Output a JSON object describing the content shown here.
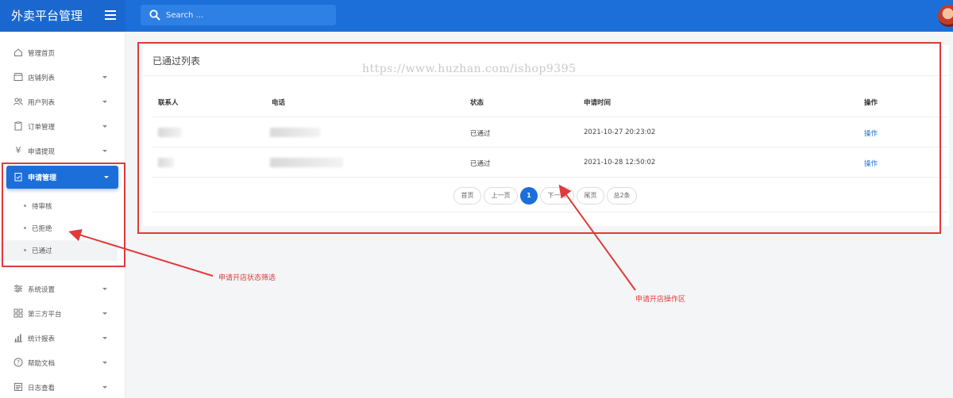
{
  "app": {
    "title": "外卖平台管理"
  },
  "search": {
    "placeholder": "Search ..."
  },
  "sidebar": {
    "items": [
      {
        "label": "管理首页",
        "icon": "home-icon",
        "has_caret": false
      },
      {
        "label": "店铺列表",
        "icon": "store-icon",
        "has_caret": true
      },
      {
        "label": "用户列表",
        "icon": "users-icon",
        "has_caret": true
      },
      {
        "label": "订单管理",
        "icon": "clipboard-icon",
        "has_caret": true
      },
      {
        "label": "申请提现",
        "icon": "yen-icon",
        "has_caret": true
      },
      {
        "label": "申请管理",
        "icon": "clipboard-check-icon",
        "has_caret": true,
        "active": true
      },
      {
        "label": "系统设置",
        "icon": "sliders-icon",
        "has_caret": true
      },
      {
        "label": "第三方平台",
        "icon": "grid-icon",
        "has_caret": true
      },
      {
        "label": "统计报表",
        "icon": "bar-chart-icon",
        "has_caret": true
      },
      {
        "label": "帮助文档",
        "icon": "help-icon",
        "has_caret": true
      },
      {
        "label": "日志查看",
        "icon": "log-icon",
        "has_caret": true
      }
    ],
    "sub_items": [
      {
        "label": "待审核"
      },
      {
        "label": "已拒绝"
      },
      {
        "label": "已通过",
        "active": true
      }
    ]
  },
  "main": {
    "title": "已通过列表",
    "watermark": "https://www.huzhan.com/ishop9395",
    "table": {
      "headers": [
        "联系人",
        "电话",
        "状态",
        "申请时间",
        "操作"
      ],
      "rows": [
        {
          "status": "已通过",
          "time": "2021-10-27 20:23:02",
          "action": "操作"
        },
        {
          "status": "已通过",
          "time": "2021-10-28 12:50:02",
          "action": "操作"
        }
      ]
    },
    "pagination": {
      "first": "首页",
      "prev": "上一页",
      "current": "1",
      "next": "下一页",
      "last": "尾页",
      "total": "总2条"
    }
  },
  "annotations": {
    "filter_note": "申请开店状态筛选",
    "operation_note": "申请开店操作区",
    "color": "#e03a3a"
  },
  "colors": {
    "primary": "#1c6fd8",
    "link": "#1c6fd8"
  }
}
